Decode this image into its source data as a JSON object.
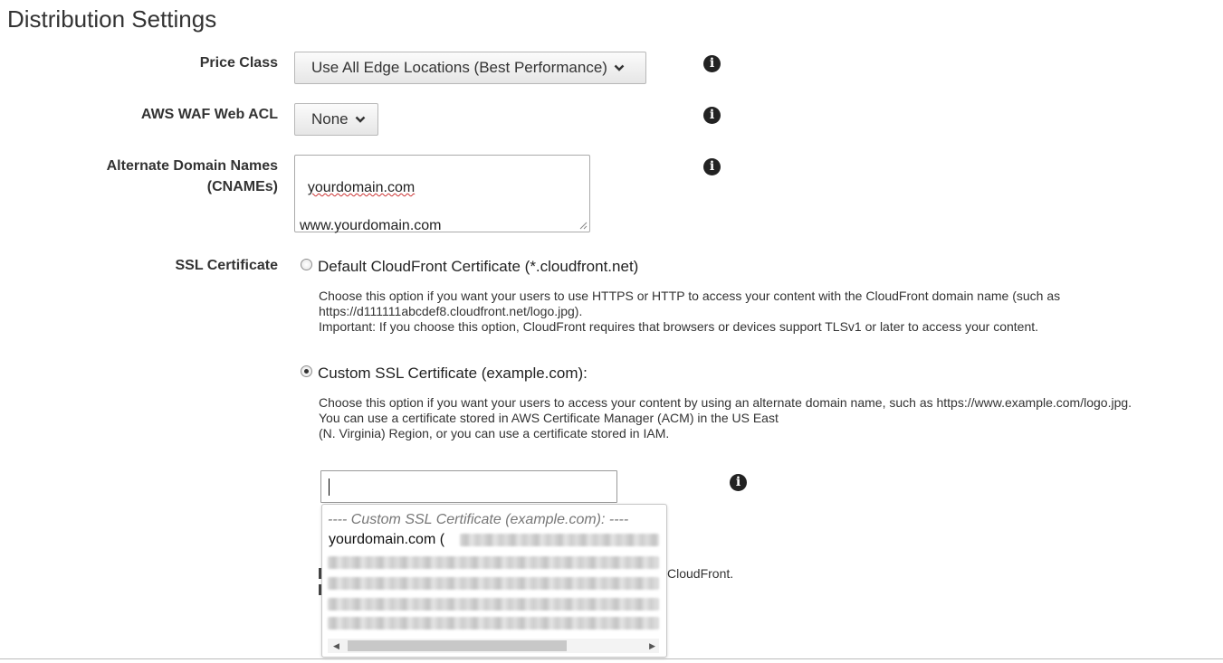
{
  "page": {
    "title": "Distribution Settings"
  },
  "price_class": {
    "label": "Price Class",
    "selected": "Use All Edge Locations (Best Performance)",
    "info_icon": "info-icon"
  },
  "waf": {
    "label": "AWS WAF Web ACL",
    "selected": "None",
    "info_icon": "info-icon"
  },
  "cnames": {
    "label_line1": "Alternate Domain Names",
    "label_line2": "(CNAMEs)",
    "line1": "yourdomain.com",
    "line2": "www.yourdomain.com",
    "info_icon": "info-icon"
  },
  "ssl": {
    "label": "SSL Certificate",
    "default_option": {
      "label": "Default CloudFront Certificate (*.cloudfront.net)",
      "checked": false,
      "help_line1": "Choose this option if you want your users to use HTTPS or HTTP to access your content with the CloudFront domain name (such as",
      "help_line2": "https://d111111abcdef8.cloudfront.net/logo.jpg).",
      "help_line3": "Important: If you choose this option, CloudFront requires that browsers or devices support TLSv1 or later to access your content."
    },
    "custom_option": {
      "label": "Custom SSL Certificate (example.com):",
      "checked": true,
      "help_line1": "Choose this option if you want your users to access your content by using an alternate domain name, such as https://www.example.com/logo.jpg.",
      "help_line2": "You can use a certificate stored in AWS Certificate Manager (ACM) in the US East",
      "help_line3": "(N. Virginia) Region, or you can use a certificate stored in IAM."
    },
    "certificate_input": {
      "value": "",
      "info_icon": "info-icon"
    },
    "dropdown": {
      "group_label": "---- Custom SSL Certificate (example.com): ----",
      "option_label": "yourdomain.com (",
      "left_arrow": "◀",
      "right_arrow": "▶"
    },
    "obscured_text": "CloudFront."
  },
  "colors": {
    "info_icon": "#222222",
    "label_text": "#333333",
    "button_gradient_top": "#fbfbfb",
    "button_gradient_bottom": "#e6e6e6"
  }
}
